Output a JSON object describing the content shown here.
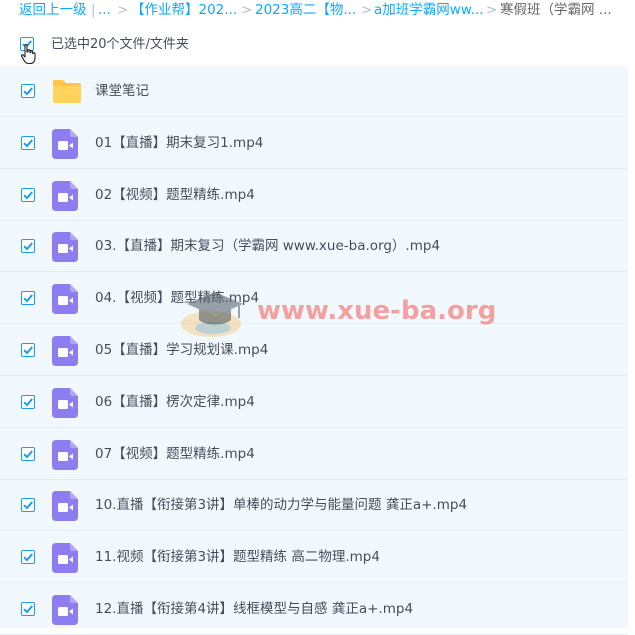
{
  "breadcrumb": {
    "back": "返回上一级",
    "sep": "|",
    "ellipsis": "...",
    "arrow": ">",
    "items": [
      "【作业帮】202...",
      "2023高二【物...",
      "a加班学霸网ww...",
      "寒假班（学霸网 ..."
    ]
  },
  "selection": {
    "label": "已选中20个文件/文件夹",
    "checked": true
  },
  "files": [
    {
      "name": "课堂笔记",
      "type": "folder"
    },
    {
      "name": "01【直播】期末复习1.mp4",
      "type": "video"
    },
    {
      "name": "02【视频】题型精练.mp4",
      "type": "video"
    },
    {
      "name": "03.【直播】期末复习（学霸网 www.xue-ba.org）.mp4",
      "type": "video"
    },
    {
      "name": "04.【视频】题型精练.mp4",
      "type": "video"
    },
    {
      "name": "05【直播】学习规划课.mp4",
      "type": "video"
    },
    {
      "name": "06【直播】楞次定律.mp4",
      "type": "video"
    },
    {
      "name": "07【视频】题型精练.mp4",
      "type": "video"
    },
    {
      "name": "10.直播【衔接第3讲】单棒的动力学与能量问题 龚正a+.mp4",
      "type": "video"
    },
    {
      "name": "11.视频【衔接第3讲】题型精练 高二物理.mp4",
      "type": "video"
    },
    {
      "name": "12.直播【衔接第4讲】线框模型与自感 龚正a+.mp4",
      "type": "video"
    }
  ],
  "watermark": "www.xue-ba.org",
  "colors": {
    "link": "#09aaff",
    "checkbox": "#1a9cf0",
    "row_bg": "#f2f9fe",
    "folder": "#ffc743",
    "video": "#8e7cf1"
  },
  "icons": {
    "folder": "folder-icon",
    "video": "video-file-icon",
    "check": "check-icon",
    "cursor": "hand-pointer-icon",
    "watermark_logo": "graduation-cap-icon"
  }
}
